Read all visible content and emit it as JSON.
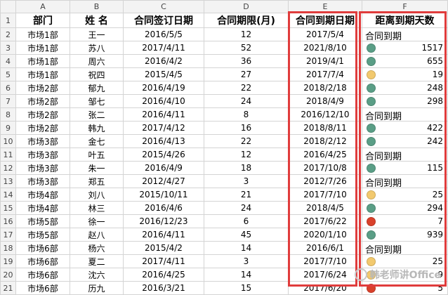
{
  "columns": [
    "A",
    "B",
    "C",
    "D",
    "E",
    "F"
  ],
  "headers": [
    "部门",
    "姓 名",
    "合同签订日期",
    "合同期限(月)",
    "合同到期日期",
    "距离到期天数"
  ],
  "colors": {
    "green": "#5a9e86",
    "yellow": "#f2c96e",
    "red": "#d9412b",
    "box": "#e03c3c"
  },
  "rows": [
    {
      "n": "2",
      "dept": "市场1部",
      "name": "王一",
      "sign": "2016/5/5",
      "term": "12",
      "due": "2017/5/4",
      "status": "expired",
      "label": "合同到期",
      "days": ""
    },
    {
      "n": "3",
      "dept": "市场1部",
      "name": "苏八",
      "sign": "2017/4/11",
      "term": "52",
      "due": "2021/8/10",
      "status": "green",
      "label": "",
      "days": "1517"
    },
    {
      "n": "4",
      "dept": "市场1部",
      "name": "周六",
      "sign": "2016/4/2",
      "term": "36",
      "due": "2019/4/1",
      "status": "green",
      "label": "",
      "days": "655"
    },
    {
      "n": "5",
      "dept": "市场1部",
      "name": "祝四",
      "sign": "2015/4/5",
      "term": "27",
      "due": "2017/7/4",
      "status": "yellow",
      "label": "",
      "days": "19"
    },
    {
      "n": "6",
      "dept": "市场2部",
      "name": "郁九",
      "sign": "2016/4/19",
      "term": "22",
      "due": "2018/2/18",
      "status": "green",
      "label": "",
      "days": "248"
    },
    {
      "n": "7",
      "dept": "市场2部",
      "name": "邹七",
      "sign": "2016/4/10",
      "term": "24",
      "due": "2018/4/9",
      "status": "green",
      "label": "",
      "days": "298"
    },
    {
      "n": "8",
      "dept": "市场2部",
      "name": "张二",
      "sign": "2016/4/11",
      "term": "8",
      "due": "2016/12/10",
      "status": "expired",
      "label": "合同到期",
      "days": ""
    },
    {
      "n": "9",
      "dept": "市场2部",
      "name": "韩九",
      "sign": "2017/4/12",
      "term": "16",
      "due": "2018/8/11",
      "status": "green",
      "label": "",
      "days": "422"
    },
    {
      "n": "10",
      "dept": "市场3部",
      "name": "金七",
      "sign": "2016/4/13",
      "term": "22",
      "due": "2018/2/12",
      "status": "green",
      "label": "",
      "days": "242"
    },
    {
      "n": "11",
      "dept": "市场3部",
      "name": "叶五",
      "sign": "2015/4/26",
      "term": "12",
      "due": "2016/4/25",
      "status": "expired",
      "label": "合同到期",
      "days": ""
    },
    {
      "n": "12",
      "dept": "市场3部",
      "name": "朱一",
      "sign": "2016/4/9",
      "term": "18",
      "due": "2017/10/8",
      "status": "green",
      "label": "",
      "days": "115"
    },
    {
      "n": "13",
      "dept": "市场3部",
      "name": "郑五",
      "sign": "2012/4/27",
      "term": "3",
      "due": "2012/7/26",
      "status": "expired",
      "label": "合同到期",
      "days": ""
    },
    {
      "n": "14",
      "dept": "市场4部",
      "name": "刘八",
      "sign": "2015/10/11",
      "term": "21",
      "due": "2017/7/10",
      "status": "yellow",
      "label": "",
      "days": "25"
    },
    {
      "n": "15",
      "dept": "市场4部",
      "name": "林三",
      "sign": "2016/4/6",
      "term": "24",
      "due": "2018/4/5",
      "status": "green",
      "label": "",
      "days": "294"
    },
    {
      "n": "16",
      "dept": "市场5部",
      "name": "徐一",
      "sign": "2016/12/23",
      "term": "6",
      "due": "2017/6/22",
      "status": "red",
      "label": "",
      "days": "7"
    },
    {
      "n": "17",
      "dept": "市场5部",
      "name": "赵八",
      "sign": "2016/4/11",
      "term": "45",
      "due": "2020/1/10",
      "status": "green",
      "label": "",
      "days": "939"
    },
    {
      "n": "18",
      "dept": "市场6部",
      "name": "杨六",
      "sign": "2015/4/2",
      "term": "14",
      "due": "2016/6/1",
      "status": "expired",
      "label": "合同到期",
      "days": ""
    },
    {
      "n": "19",
      "dept": "市场6部",
      "name": "夏二",
      "sign": "2017/4/11",
      "term": "3",
      "due": "2017/7/10",
      "status": "yellow",
      "label": "",
      "days": "25"
    },
    {
      "n": "20",
      "dept": "市场6部",
      "name": "沈六",
      "sign": "2016/4/25",
      "term": "14",
      "due": "2017/6/24",
      "status": "yellow",
      "label": "",
      "days": "9"
    },
    {
      "n": "21",
      "dept": "市场6部",
      "name": "历九",
      "sign": "2016/3/21",
      "term": "15",
      "due": "2017/6/20",
      "status": "red",
      "label": "",
      "days": "5"
    }
  ],
  "watermark": "韩老师讲Office"
}
